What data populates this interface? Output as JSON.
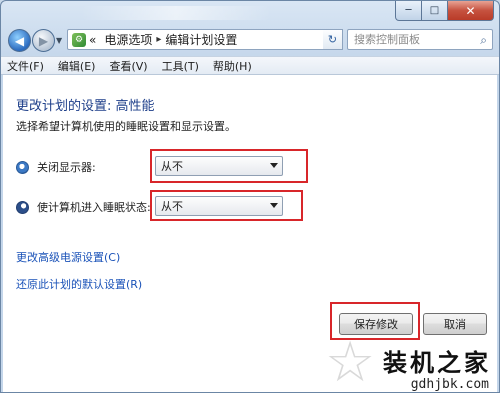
{
  "window": {
    "caption_buttons": {
      "minimize": "─",
      "maximize": "□",
      "close": "✕"
    }
  },
  "nav": {
    "back_icon": "◀",
    "forward_icon": "▶",
    "breadcrumb_prefix": "«",
    "breadcrumbs": [
      "电源选项",
      "编辑计划设置"
    ],
    "separator": "▸",
    "refresh_icon": "↻",
    "search_placeholder": "搜索控制面板"
  },
  "menu": [
    "文件(F)",
    "编辑(E)",
    "查看(V)",
    "工具(T)",
    "帮助(H)"
  ],
  "main": {
    "heading": "更改计划的设置: 高性能",
    "subtext": "选择希望计算机使用的睡眠设置和显示设置。",
    "settings": [
      {
        "label": "关闭显示器:",
        "value": "从不",
        "icon": "monitor-icon"
      },
      {
        "label": "使计算机进入睡眠状态:",
        "value": "从不",
        "icon": "moon-icon"
      }
    ],
    "links": [
      "更改高级电源设置(C)",
      "还原此计划的默认设置(R)"
    ],
    "buttons": {
      "save": "保存修改",
      "cancel": "取消"
    }
  },
  "watermark": {
    "text": "装机之家",
    "url": "gdhjbk.com"
  },
  "colors": {
    "highlight": "#d8262a",
    "link": "#1a52b8",
    "heading": "#1e3f8a"
  }
}
